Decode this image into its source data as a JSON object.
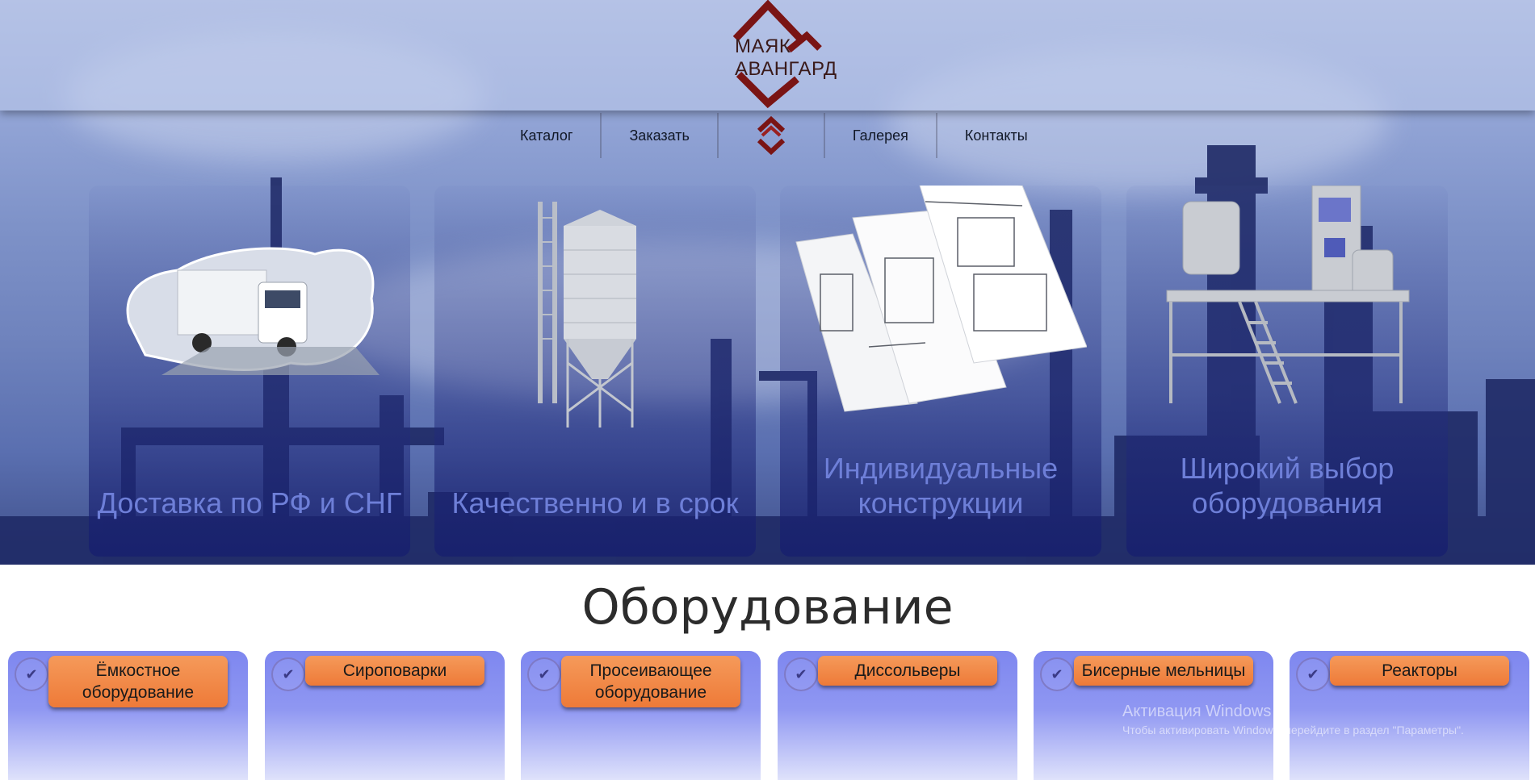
{
  "logo": {
    "line1": "МАЯК",
    "line2": "АВАНГАРД"
  },
  "nav": {
    "items": [
      "Каталог",
      "Заказать",
      "Галерея",
      "Контакты"
    ]
  },
  "features": [
    {
      "title": "Доставка по РФ и СНГ"
    },
    {
      "title": "Качественно и в срок"
    },
    {
      "title": "Индивидуальные конструкции"
    },
    {
      "title": "Широкий выбор оборудования"
    }
  ],
  "section": {
    "title": "Оборудование"
  },
  "categories": [
    {
      "label": "Ёмкостное оборудование"
    },
    {
      "label": "Сироповарки"
    },
    {
      "label": "Просеивающее оборудование"
    },
    {
      "label": "Диссольверы"
    },
    {
      "label": "Бисерные мельницы"
    },
    {
      "label": "Реакторы"
    }
  ],
  "watermark": {
    "title": "Активация Windows",
    "subtitle": "Чтобы активировать Windows, перейдите в раздел \"Параметры\"."
  },
  "colors": {
    "brand": "#7a1414",
    "accent": "#ee7a38",
    "card_bg": "#8f97f2"
  },
  "icons": {
    "check": "check-icon"
  }
}
